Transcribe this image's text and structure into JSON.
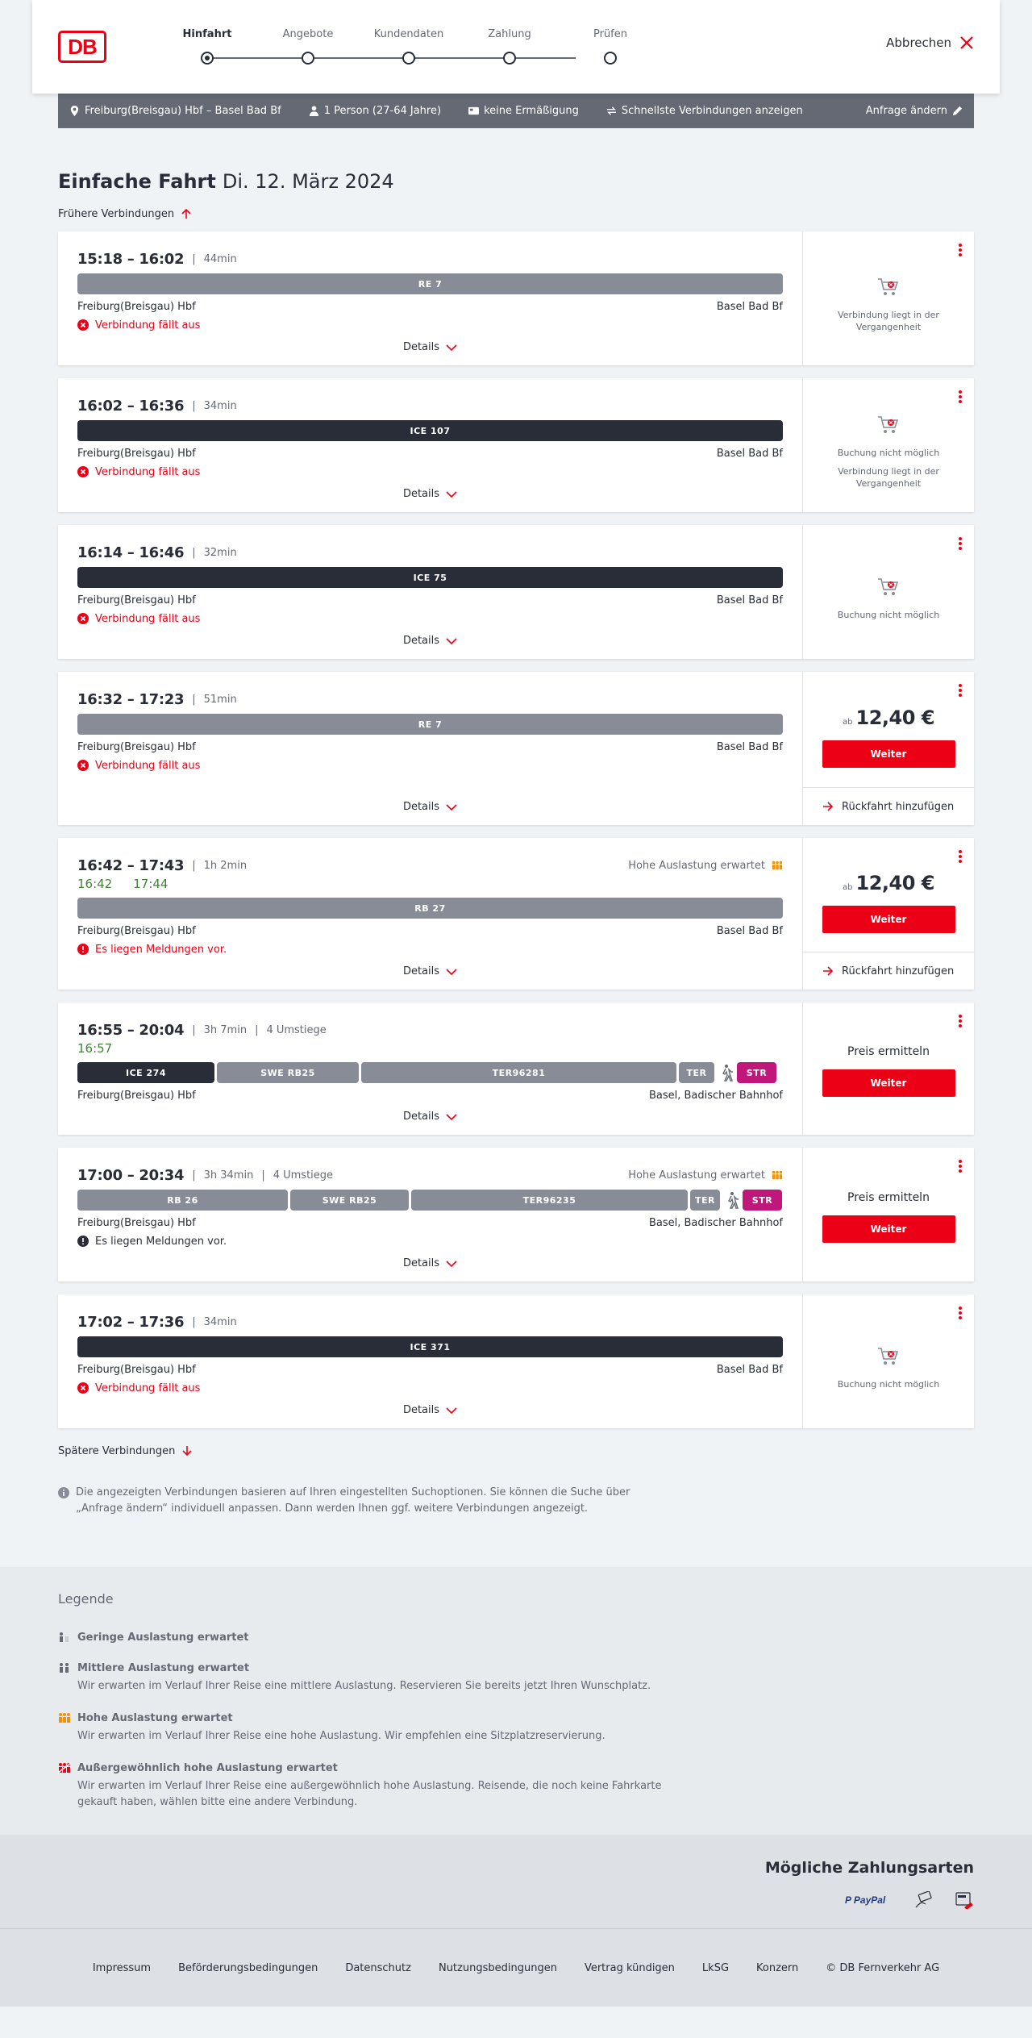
{
  "header": {
    "logo": "DB",
    "steps": [
      "Hinfahrt",
      "Angebote",
      "Kundendaten",
      "Zahlung",
      "Prüfen"
    ],
    "cancel_label": "Abbrechen"
  },
  "search": {
    "route": "Freiburg(Breisgau) Hbf – Basel Bad Bf",
    "passengers": "1 Person (27-64 Jahre)",
    "discount": "keine Ermäßigung",
    "fastest": "Schnellste Verbindungen anzeigen",
    "edit": "Anfrage ändern"
  },
  "page": {
    "title_bold": "Einfache Fahrt",
    "title_date": "Di. 12. März 2024",
    "earlier": "Frühere Verbindungen",
    "later": "Spätere Verbindungen",
    "info": "Die angezeigten Verbindungen basieren auf Ihren eingestellten Suchoptionen. Sie können die Suche über „Anfrage ändern“ individuell anpassen. Dann werden Ihnen ggf. weitere Verbindungen angezeigt.",
    "details_label": "Details",
    "currency_prefix": "ab",
    "continue_label": "Weiter",
    "return_label": "Rückfahrt hinzufügen",
    "price_lookup": "Preis ermitteln"
  },
  "connections": [
    {
      "time": "15:18 – 16:02",
      "duration": "44min",
      "segments": [
        {
          "label": "RE 7",
          "type": "regio"
        }
      ],
      "from": "Freiburg(Breisgau) Hbf",
      "to": "Basel Bad Bf",
      "notice": "Verbindung fällt aus",
      "right_texts": [
        "Verbindung liegt in der Vergangenheit"
      ]
    },
    {
      "time": "16:02 – 16:36",
      "duration": "34min",
      "segments": [
        {
          "label": "ICE 107",
          "type": "ice"
        }
      ],
      "from": "Freiburg(Breisgau) Hbf",
      "to": "Basel Bad Bf",
      "notice": "Verbindung fällt aus",
      "right_texts": [
        "Buchung nicht möglich",
        "Verbindung liegt in der Vergangenheit"
      ]
    },
    {
      "time": "16:14 – 16:46",
      "duration": "32min",
      "segments": [
        {
          "label": "ICE 75",
          "type": "ice"
        }
      ],
      "from": "Freiburg(Breisgau) Hbf",
      "to": "Basel Bad Bf",
      "notice": "Verbindung fällt aus",
      "right_texts": [
        "Buchung nicht möglich"
      ]
    },
    {
      "time": "16:32 – 17:23",
      "duration": "51min",
      "segments": [
        {
          "label": "RE 7",
          "type": "regio"
        }
      ],
      "from": "Freiburg(Breisgau) Hbf",
      "to": "Basel Bad Bf",
      "notice": "Verbindung fällt aus",
      "price": "12,40 €"
    },
    {
      "time": "16:42 – 17:43",
      "duration": "1h 2min",
      "load": "Hohe Auslastung erwartet",
      "realtime_dep": "16:42",
      "realtime_arr": "17:44",
      "segments": [
        {
          "label": "RB 27",
          "type": "regio"
        }
      ],
      "from": "Freiburg(Breisgau) Hbf",
      "to": "Basel Bad Bf",
      "notice": "Es liegen Meldungen vor.",
      "price": "12,40 €"
    },
    {
      "time": "16:55 – 20:04",
      "duration": "3h 7min",
      "changes": "4 Umstiege",
      "realtime_dep": "16:57",
      "segments": [
        {
          "label": "ICE 274",
          "type": "ice"
        },
        {
          "label": "SWE RB25",
          "type": "regio"
        },
        {
          "label": "TER96281",
          "type": "regio"
        },
        {
          "label": "TER",
          "type": "regio"
        },
        {
          "label": "",
          "type": "walk"
        },
        {
          "label": "STR",
          "type": "str"
        }
      ],
      "from": "Freiburg(Breisgau) Hbf",
      "to": "Basel, Badischer Bahnhof"
    },
    {
      "time": "17:00 – 20:34",
      "duration": "3h 34min",
      "changes": "4 Umstiege",
      "load": "Hohe Auslastung erwartet",
      "segments": [
        {
          "label": "RB 26",
          "type": "regio"
        },
        {
          "label": "SWE RB25",
          "type": "regio"
        },
        {
          "label": "TER96235",
          "type": "regio"
        },
        {
          "label": "TER",
          "type": "regio"
        },
        {
          "label": "",
          "type": "walk"
        },
        {
          "label": "STR",
          "type": "str"
        }
      ],
      "from": "Freiburg(Breisgau) Hbf",
      "to": "Basel, Badischer Bahnhof",
      "notice": "Es liegen Meldungen vor."
    },
    {
      "time": "17:02 – 17:36",
      "duration": "34min",
      "segments": [
        {
          "label": "ICE 371",
          "type": "ice"
        }
      ],
      "from": "Freiburg(Breisgau) Hbf",
      "to": "Basel Bad Bf",
      "notice": "Verbindung fällt aus",
      "right_texts": [
        "Buchung nicht möglich"
      ]
    }
  ],
  "legend": {
    "title": "Legende",
    "items": [
      {
        "title": "Geringe Auslastung erwartet",
        "desc": ""
      },
      {
        "title": "Mittlere Auslastung erwartet",
        "desc": "Wir erwarten im Verlauf Ihrer Reise eine mittlere Auslastung. Reservieren Sie bereits jetzt Ihren Wunschplatz."
      },
      {
        "title": "Hohe Auslastung erwartet",
        "desc": "Wir erwarten im Verlauf Ihrer Reise eine hohe Auslastung. Wir empfehlen eine Sitzplatzreservierung."
      },
      {
        "title": "Außergewöhnlich hohe Auslastung erwartet",
        "desc": "Wir erwarten im Verlauf Ihrer Reise eine außergewöhnlich hohe Auslastung. Reisende, die noch keine Fahrkarte gekauft haben, wählen bitte eine andere Verbindung."
      }
    ]
  },
  "payments": {
    "title": "Mögliche Zahlungsarten",
    "methods": [
      "PayPal",
      "Kreditkarte",
      "SEPA-Lastschrift"
    ]
  },
  "footer": {
    "links": [
      "Impressum",
      "Beförderungsbedingungen",
      "Datenschutz",
      "Nutzungsbedingungen",
      "Vertrag kündigen",
      "LkSG",
      "Konzern",
      "© DB Fernverkehr AG"
    ]
  },
  "colors": {
    "db_red": "#ec0016",
    "ice": "#282d37",
    "regio": "#878c96",
    "tram": "#c0187a",
    "realtime_green": "#408335",
    "load_orange": "#f39200"
  }
}
